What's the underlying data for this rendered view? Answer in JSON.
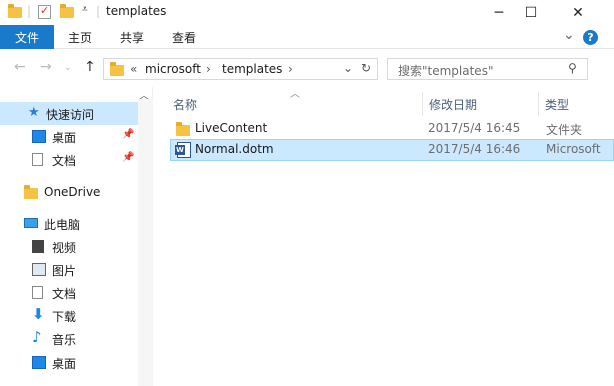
{
  "window": {
    "title": "templates",
    "controls": {
      "minimize": "─",
      "maximize": "☐",
      "close": "✕"
    }
  },
  "ribbon": {
    "tabs": [
      {
        "label": "文件"
      },
      {
        "label": "主页"
      },
      {
        "label": "共享"
      },
      {
        "label": "查看"
      }
    ],
    "expand": "⌄",
    "help": "?"
  },
  "address": {
    "prefix": "«",
    "crumbs": [
      "microsoft",
      "templates"
    ],
    "search_placeholder": "搜索\"templates\""
  },
  "nav": {
    "items": [
      {
        "label": "快速访问",
        "icon": "star-icon",
        "selected": true
      },
      {
        "label": "桌面",
        "icon": "desktop-icon",
        "pinned": true
      },
      {
        "label": "文档",
        "icon": "documents-icon",
        "pinned": true
      },
      {
        "label": "OneDrive",
        "icon": "onedrive-folder-icon"
      },
      {
        "label": "此电脑",
        "icon": "this-pc-icon"
      },
      {
        "label": "视频",
        "icon": "video-icon"
      },
      {
        "label": "图片",
        "icon": "pictures-icon"
      },
      {
        "label": "文档",
        "icon": "documents-icon"
      },
      {
        "label": "下载",
        "icon": "download-icon"
      },
      {
        "label": "音乐",
        "icon": "music-icon"
      },
      {
        "label": "桌面",
        "icon": "desktop-icon"
      }
    ]
  },
  "files": {
    "columns": {
      "name": "名称",
      "modified": "修改日期",
      "type": "类型"
    },
    "rows": [
      {
        "name": "LiveContent",
        "modified": "2017/5/4 16:45",
        "type": "文件夹",
        "icon": "folder-icon",
        "selected": false
      },
      {
        "name": "Normal.dotm",
        "modified": "2017/5/4 16:46",
        "type": "Microsoft",
        "icon": "word-template-icon",
        "selected": true
      }
    ]
  },
  "colors": {
    "accent": "#1979ca",
    "selection": "#cce8ff",
    "folder": "#f6c243"
  }
}
